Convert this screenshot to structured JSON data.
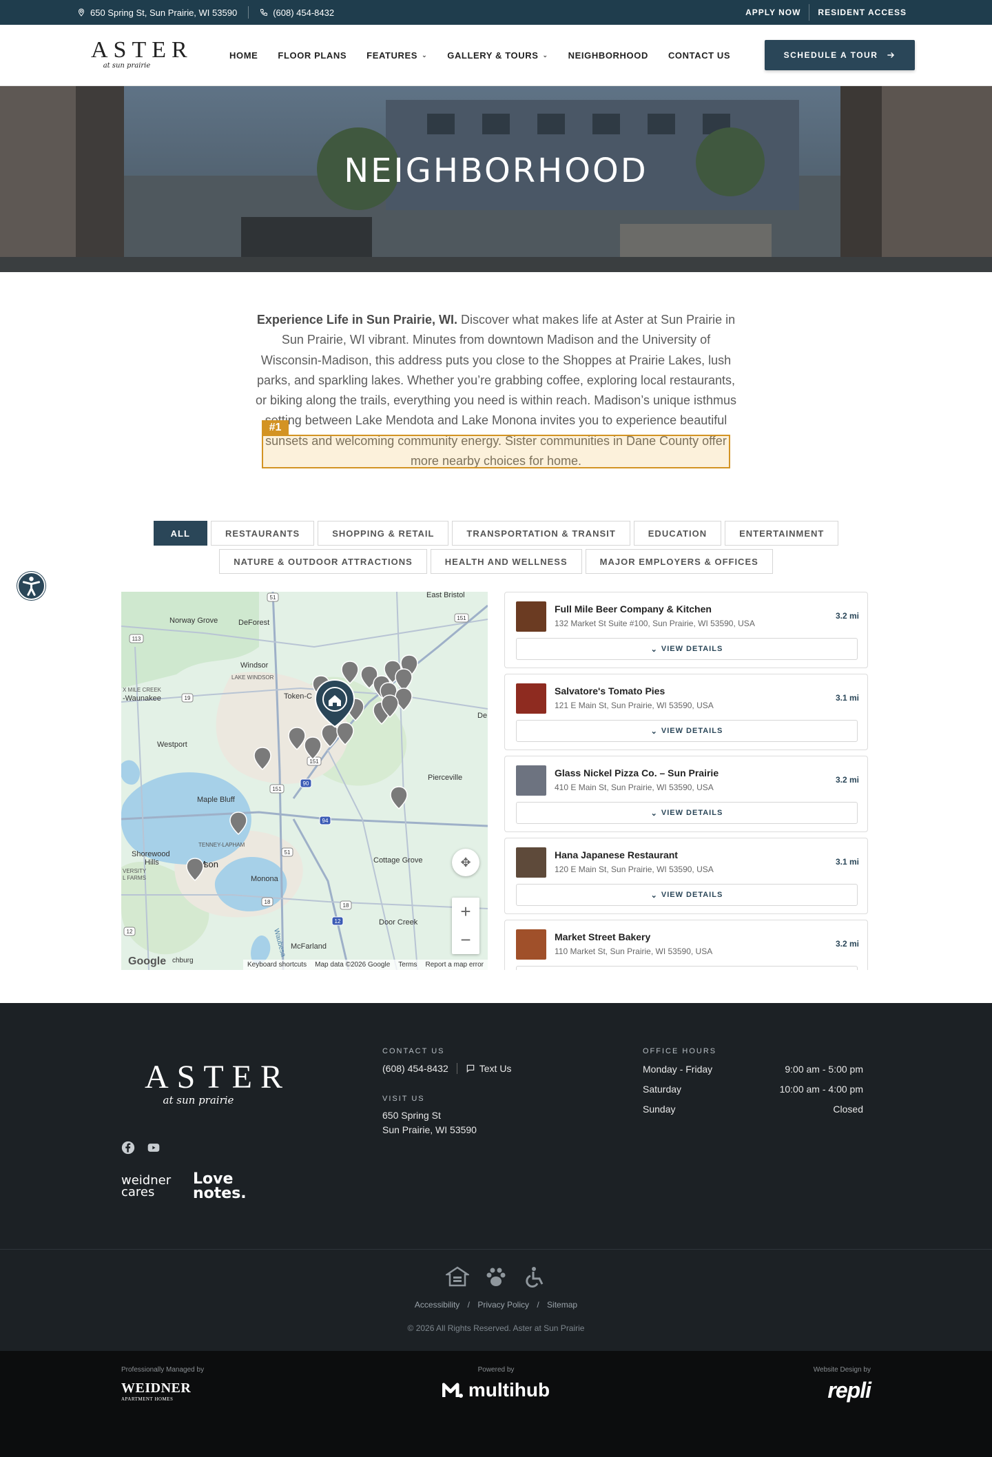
{
  "topbar": {
    "address": "650 Spring St, Sun Prairie, WI 53590",
    "phone": "(608) 454-8432",
    "apply_now": "APPLY NOW",
    "resident_access": "RESIDENT ACCESS"
  },
  "header": {
    "logo_main": "ASTER",
    "logo_sub": "at sun prairie",
    "nav": {
      "home": "HOME",
      "floor_plans": "FLOOR PLANS",
      "features": "FEATURES",
      "gallery": "GALLERY & TOURS",
      "neighborhood": "NEIGHBORHOOD",
      "contact": "CONTACT US"
    },
    "cta": "SCHEDULE A TOUR"
  },
  "hero": {
    "title": "NEIGHBORHOOD"
  },
  "intro": {
    "lead": "Experience Life in Sun Prairie, WI.",
    "body": " Discover what makes life at Aster at Sun Prairie in Sun Prairie, WI vibrant. Minutes from downtown Madison and the University of Wisconsin-Madison, this address puts you close to the Shoppes at Prairie Lakes, lush parks, and sparkling lakes. Whether you’re grabbing coffee, exploring local restaurants, or biking along the trails, everything you need is within reach. Madison’s unique isthmus setting between Lake Mendota and Lake Monona invites you to experience beautiful sunsets and welcoming community energy. Sister communities in Dane County offer more nearby choices for home.",
    "highlight_tag": "#1"
  },
  "filters": {
    "row1": [
      "ALL",
      "RESTAURANTS",
      "SHOPPING & RETAIL",
      "TRANSPORTATION & TRANSIT",
      "EDUCATION",
      "ENTERTAINMENT"
    ],
    "row2": [
      "NATURE & OUTDOOR ATTRACTIONS",
      "HEALTH AND WELLNESS",
      "MAJOR EMPLOYERS & OFFICES"
    ],
    "active": "ALL"
  },
  "map": {
    "labels": {
      "east_bristol": "East Bristol",
      "norway_grove": "Norway Grove",
      "deforest": "DeForest",
      "windsor": "Windsor",
      "lake_windsor": "LAKE WINDSOR",
      "six_mile": "X MILE CREEK",
      "waunakee": "-Waunakee",
      "token": "Token-C",
      "westport": "Westport",
      "pierceville": "Pierceville",
      "maple_bluff": "Maple Bluff",
      "tenney": "TENNEY-LAPHAM",
      "shorewood": "Shorewood",
      "hills": "Hills",
      "versity": "VERSITY",
      "farms": "L FARMS",
      "madison": "M",
      "madison2": "son",
      "monona": "Monona",
      "cottage_grove": "Cottage Grove",
      "door_creek": "Door Creek",
      "mcfarland": "McFarland",
      "waubesa": "Waubesa",
      "de": "De",
      "chburg": "chburg",
      "google": "Google"
    },
    "routes": [
      "51",
      "151",
      "113",
      "19",
      "151",
      "90",
      "94",
      "51",
      "18",
      "12",
      "18",
      "12",
      "151"
    ],
    "attribution": {
      "shortcuts": "Keyboard shortcuts",
      "data": "Map data ©2026 Google",
      "terms": "Terms",
      "report": "Report a map error"
    }
  },
  "listings": {
    "view_details": "VIEW DETAILS",
    "items": [
      {
        "name": "Full Mile Beer Company & Kitchen",
        "address": "132 Market St Suite #100, Sun Prairie, WI 53590, USA",
        "distance": "3.2 mi",
        "thumb_color": "#6b3b22"
      },
      {
        "name": "Salvatore's Tomato Pies",
        "address": "121 E Main St, Sun Prairie, WI 53590, USA",
        "distance": "3.1 mi",
        "thumb_color": "#8e2b20"
      },
      {
        "name": "Glass Nickel Pizza Co. – Sun Prairie",
        "address": "410 E Main St, Sun Prairie, WI 53590, USA",
        "distance": "3.2 mi",
        "thumb_color": "#6d7380"
      },
      {
        "name": "Hana Japanese Restaurant",
        "address": "120 E Main St, Sun Prairie, WI 53590, USA",
        "distance": "3.1 mi",
        "thumb_color": "#5e4a3a"
      },
      {
        "name": "Market Street Bakery",
        "address": "110 Market St, Sun Prairie, WI 53590, USA",
        "distance": "3.2 mi",
        "thumb_color": "#a0502a"
      }
    ]
  },
  "footer": {
    "logo_main": "ASTER",
    "logo_sub": "at sun prairie",
    "contact_heading": "CONTACT US",
    "phone": "(608) 454-8432",
    "text_us": "Text Us",
    "visit_heading": "VISIT US",
    "address_line1": "650 Spring St",
    "address_line2": "Sun Prairie, WI 53590",
    "hours_heading": "OFFICE HOURS",
    "hours": [
      {
        "day": "Monday - Friday",
        "time": "9:00 am - 5:00 pm"
      },
      {
        "day": "Saturday",
        "time": "10:00 am - 4:00 pm"
      },
      {
        "day": "Sunday",
        "time": "Closed"
      }
    ],
    "badge_weidner": "weidner cares",
    "badge_love": "Love notes.",
    "links": {
      "accessibility": "Accessibility",
      "privacy": "Privacy Policy",
      "sitemap": "Sitemap"
    },
    "copyright": "© 2026 All Rights Reserved. Aster at Sun Prairie"
  },
  "bottom": {
    "managed_label": "Professionally Managed by",
    "managed_name": "WEIDNER",
    "managed_sub": "APARTMENT HOMES",
    "powered_label": "Powered by",
    "powered_name": "multihub",
    "design_label": "Website Design by",
    "design_name": "repli"
  },
  "colors": {
    "brand": "#2a4658",
    "topbar": "#1f3d4d",
    "highlight": "#d39323",
    "footer": "#1c2125"
  }
}
